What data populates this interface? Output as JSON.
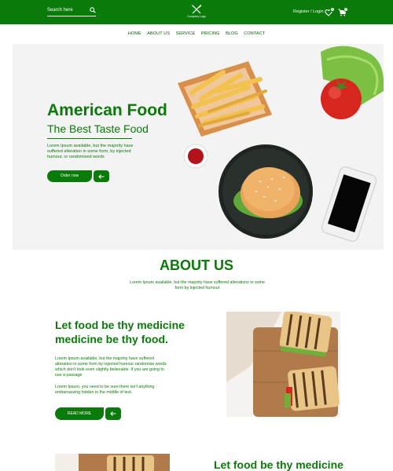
{
  "header": {
    "search_label": "Search here",
    "logo_text": "Company Logo",
    "register_login": "Register / Login",
    "wishlist_count": "0",
    "cart_count": "0"
  },
  "nav": {
    "items": [
      "HOME",
      "ABOUT US",
      "SERVICE",
      "PRICING",
      "BLOG",
      "CONTACT"
    ]
  },
  "hero": {
    "title": "American Food",
    "subtitle": "The Best Taste Food",
    "text": "Lorem Ipsum available, but the majority have suffered alteration in some form, by injected humour, or randomised words",
    "order_button": "Order now"
  },
  "about": {
    "title": "ABOUT US",
    "text": "Lorem Ipsum available, but the majority have suffered alterationz in some form by injected humour"
  },
  "section1": {
    "title": "Let food be thy medicine medicine be thy food.",
    "paragraph1": "Lorem Ipsum available, but the majority have suffered alteration in some form by injected humour randomise words which don't look even slightly believable. If you are going to use a passage",
    "paragraph2": "Lorem Ipsum, you need to be sure there isn't anything embarrassing hidden in the middle of text.",
    "read_more": "READ MORE"
  },
  "section2": {
    "title": "Let food be thy medicine"
  },
  "colors": {
    "brand_green": "#0a7a0a",
    "background": "#ffffff"
  },
  "icons": {
    "search": "search-icon",
    "logo": "fork-knife-icon",
    "wishlist": "heart-icon",
    "cart": "cart-icon",
    "arrow": "arrow-left-icon"
  }
}
